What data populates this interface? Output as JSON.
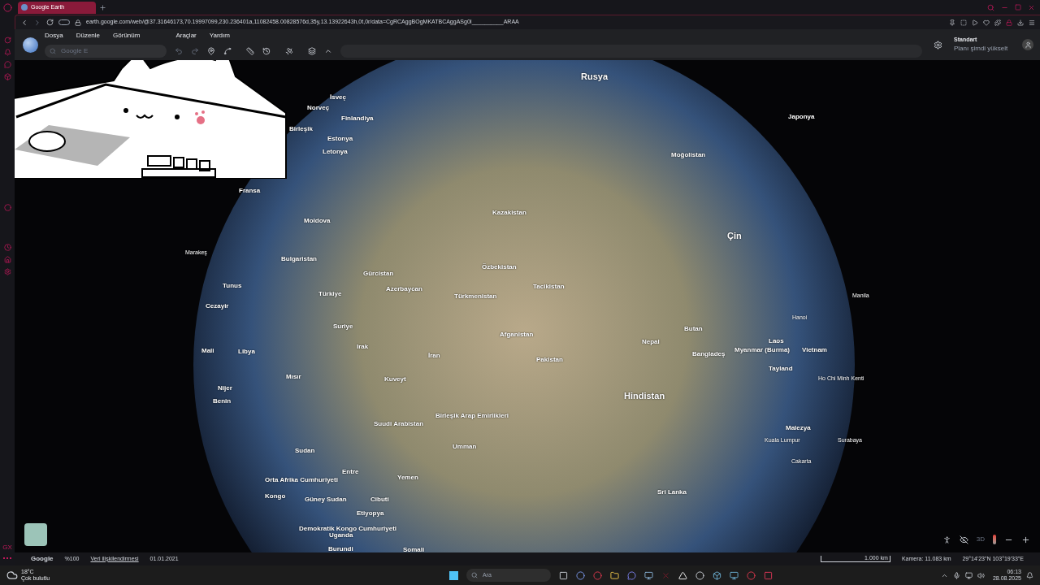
{
  "browser": {
    "tabs": [
      {
        "title": "Google Earth",
        "selected": true
      }
    ],
    "url": "earth.google.com/web/@37.31646173,70.19997099,230.236401a,11082458.00828576d,35y,13.13922643h,0t,0r/data=CgRCAggBOgMKATBCAggASg0I__________ARAA"
  },
  "earth": {
    "menu": [
      "Dosya",
      "Düzenle",
      "Görünüm",
      "Araçlar",
      "Yardım"
    ],
    "search": {
      "placeholder": "Google E"
    },
    "plan": {
      "title": "Standart",
      "subtitle": "Planı şimdi yükselt"
    },
    "map_labels": [
      {
        "text": "Rusya",
        "kind": "major"
      },
      {
        "text": "İsveç",
        "kind": "country"
      },
      {
        "text": "Norveç",
        "kind": "country"
      },
      {
        "text": "Finlandiya",
        "kind": "country"
      },
      {
        "text": "Birleşik",
        "kind": "country"
      },
      {
        "text": "Estonya",
        "kind": "country"
      },
      {
        "text": "Letonya",
        "kind": "country"
      },
      {
        "text": "Moğolistan",
        "kind": "country"
      },
      {
        "text": "Japonya",
        "kind": "country"
      },
      {
        "text": "Fransa",
        "kind": "country"
      },
      {
        "text": "Kazakistan",
        "kind": "country"
      },
      {
        "text": "Moldova",
        "kind": "country"
      },
      {
        "text": "Çin",
        "kind": "major"
      },
      {
        "text": "Marakeş",
        "kind": "city"
      },
      {
        "text": "Bulgaristan",
        "kind": "country"
      },
      {
        "text": "Özbekistan",
        "kind": "country"
      },
      {
        "text": "Gürcistan",
        "kind": "country"
      },
      {
        "text": "Tunus",
        "kind": "country"
      },
      {
        "text": "Tacikistan",
        "kind": "country"
      },
      {
        "text": "Azerbaycan",
        "kind": "country"
      },
      {
        "text": "Türkiye",
        "kind": "country"
      },
      {
        "text": "Türkmenistan",
        "kind": "country"
      },
      {
        "text": "Manila",
        "kind": "city"
      },
      {
        "text": "Cezayir",
        "kind": "country"
      },
      {
        "text": "Hanoi",
        "kind": "city"
      },
      {
        "text": "Suriye",
        "kind": "country"
      },
      {
        "text": "Afganistan",
        "kind": "country"
      },
      {
        "text": "Butan",
        "kind": "country"
      },
      {
        "text": "Laos",
        "kind": "country"
      },
      {
        "text": "Nepal",
        "kind": "country"
      },
      {
        "text": "Irak",
        "kind": "country"
      },
      {
        "text": "Mali",
        "kind": "country"
      },
      {
        "text": "Libya",
        "kind": "country"
      },
      {
        "text": "İran",
        "kind": "country"
      },
      {
        "text": "Myanmar (Burma)",
        "kind": "country"
      },
      {
        "text": "Vietnam",
        "kind": "country"
      },
      {
        "text": "Bangladeş",
        "kind": "country"
      },
      {
        "text": "Pakistan",
        "kind": "country"
      },
      {
        "text": "Tayland",
        "kind": "country"
      },
      {
        "text": "Mısır",
        "kind": "country"
      },
      {
        "text": "Kuveyt",
        "kind": "country"
      },
      {
        "text": "Ho Chi Minh Kenti",
        "kind": "city"
      },
      {
        "text": "Nijer",
        "kind": "country"
      },
      {
        "text": "Hindistan",
        "kind": "major"
      },
      {
        "text": "Benin",
        "kind": "country"
      },
      {
        "text": "Birleşik Arap Emirlikleri",
        "kind": "country"
      },
      {
        "text": "Suudi Arabistan",
        "kind": "country"
      },
      {
        "text": "Malezya",
        "kind": "country"
      },
      {
        "text": "Kuala Lumpur",
        "kind": "city"
      },
      {
        "text": "Surabaya",
        "kind": "city"
      },
      {
        "text": "Umman",
        "kind": "country"
      },
      {
        "text": "Sudan",
        "kind": "country"
      },
      {
        "text": "Cakarta",
        "kind": "city"
      },
      {
        "text": "Entre",
        "kind": "country"
      },
      {
        "text": "Orta Afrika Cumhuriyeti",
        "kind": "country"
      },
      {
        "text": "Yemen",
        "kind": "country"
      },
      {
        "text": "Sri Lanka",
        "kind": "country"
      },
      {
        "text": "Kongo",
        "kind": "country"
      },
      {
        "text": "Güney Sudan",
        "kind": "country"
      },
      {
        "text": "Cibuti",
        "kind": "country"
      },
      {
        "text": "Etiyopya",
        "kind": "country"
      },
      {
        "text": "Demokratik Kongo Cumhuriyeti",
        "kind": "country"
      },
      {
        "text": "Uganda",
        "kind": "country"
      },
      {
        "text": "Burundi",
        "kind": "country"
      },
      {
        "text": "Somali",
        "kind": "country"
      }
    ],
    "controls": {
      "view_3d": "3D"
    },
    "status_bar": {
      "brand": "Google",
      "zoom": "%100",
      "attribution": "Veri ilişkilendirmesi",
      "date": "01.01.2021",
      "scale": "1.000 km",
      "camera": "Kamera: 11.083 km",
      "coordinates": "29°14'23\"N 103°19'33\"E"
    }
  },
  "sidebar": {
    "badge": "GX"
  },
  "taskbar": {
    "weather": {
      "temp": "18°C",
      "condition": "Çok bulutlu"
    },
    "search": {
      "placeholder": "Ara"
    },
    "time": "06:13",
    "date": "28.08.2025"
  }
}
